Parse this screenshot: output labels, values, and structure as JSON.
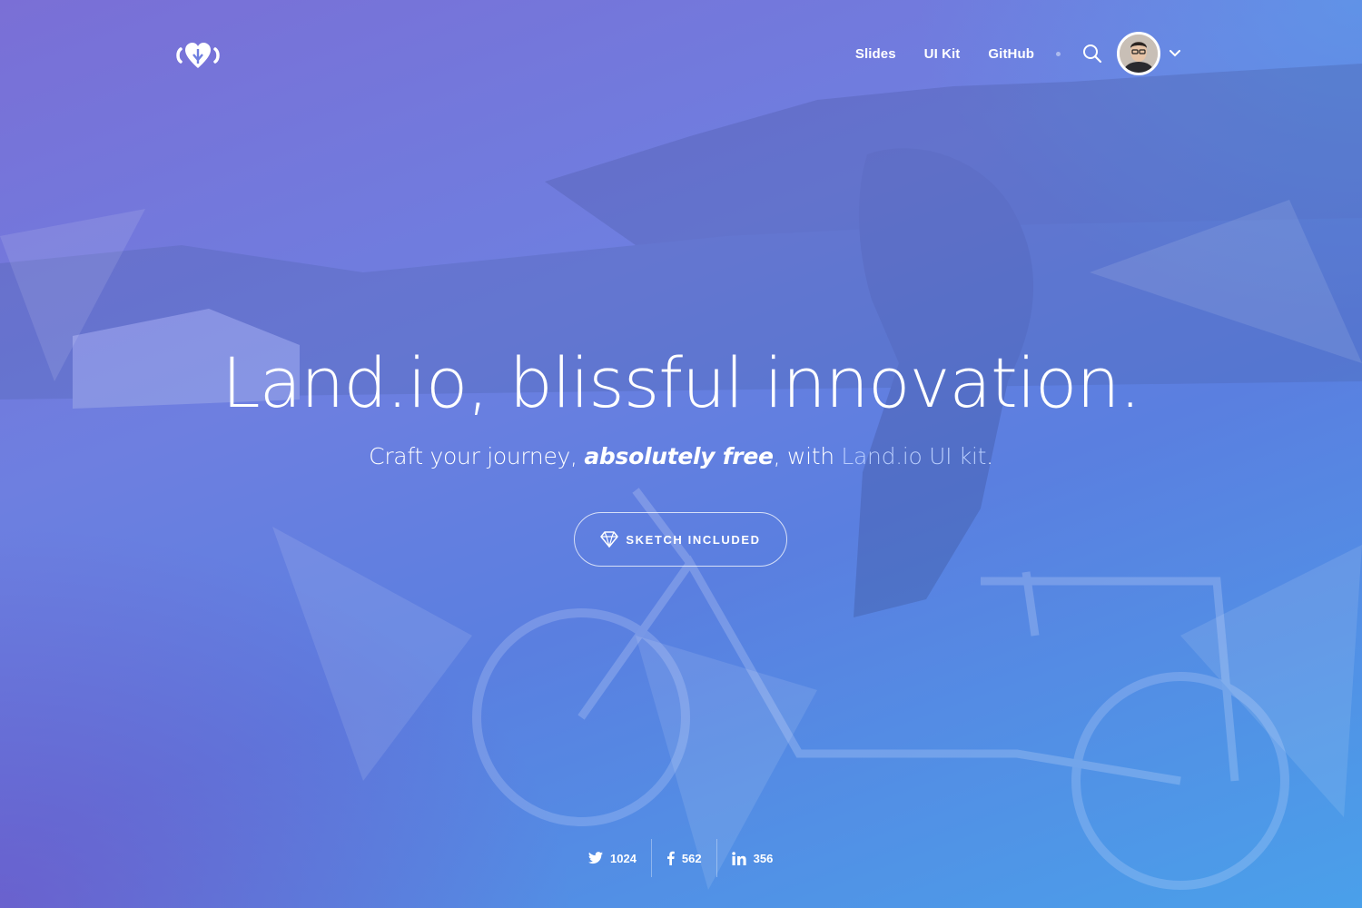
{
  "brand": {
    "logo_icon": "land-io-logo-icon"
  },
  "nav": {
    "links": [
      "Slides",
      "UI Kit",
      "GitHub"
    ],
    "search_icon": "search-icon",
    "avatar_icon": "user-avatar",
    "dropdown_icon": "chevron-down-icon"
  },
  "hero": {
    "title": "Land.io, blissful innovation.",
    "subtitle_start": "Craft your journey, ",
    "subtitle_emphasis": "absolutely free",
    "subtitle_middle": ", with ",
    "subtitle_link": "Land.io UI kit",
    "subtitle_end": "."
  },
  "cta": {
    "label": "SKETCH INCLUDED",
    "icon": "diamond-icon"
  },
  "share": [
    {
      "icon": "twitter-icon",
      "count": "1024"
    },
    {
      "icon": "facebook-icon",
      "count": "562"
    },
    {
      "icon": "linkedin-icon",
      "count": "356"
    }
  ],
  "colors": {
    "gradient_start": "#7a6fd6",
    "gradient_end": "#4aa0ea",
    "accent_link": "#bed2ff",
    "text": "#ffffff"
  }
}
